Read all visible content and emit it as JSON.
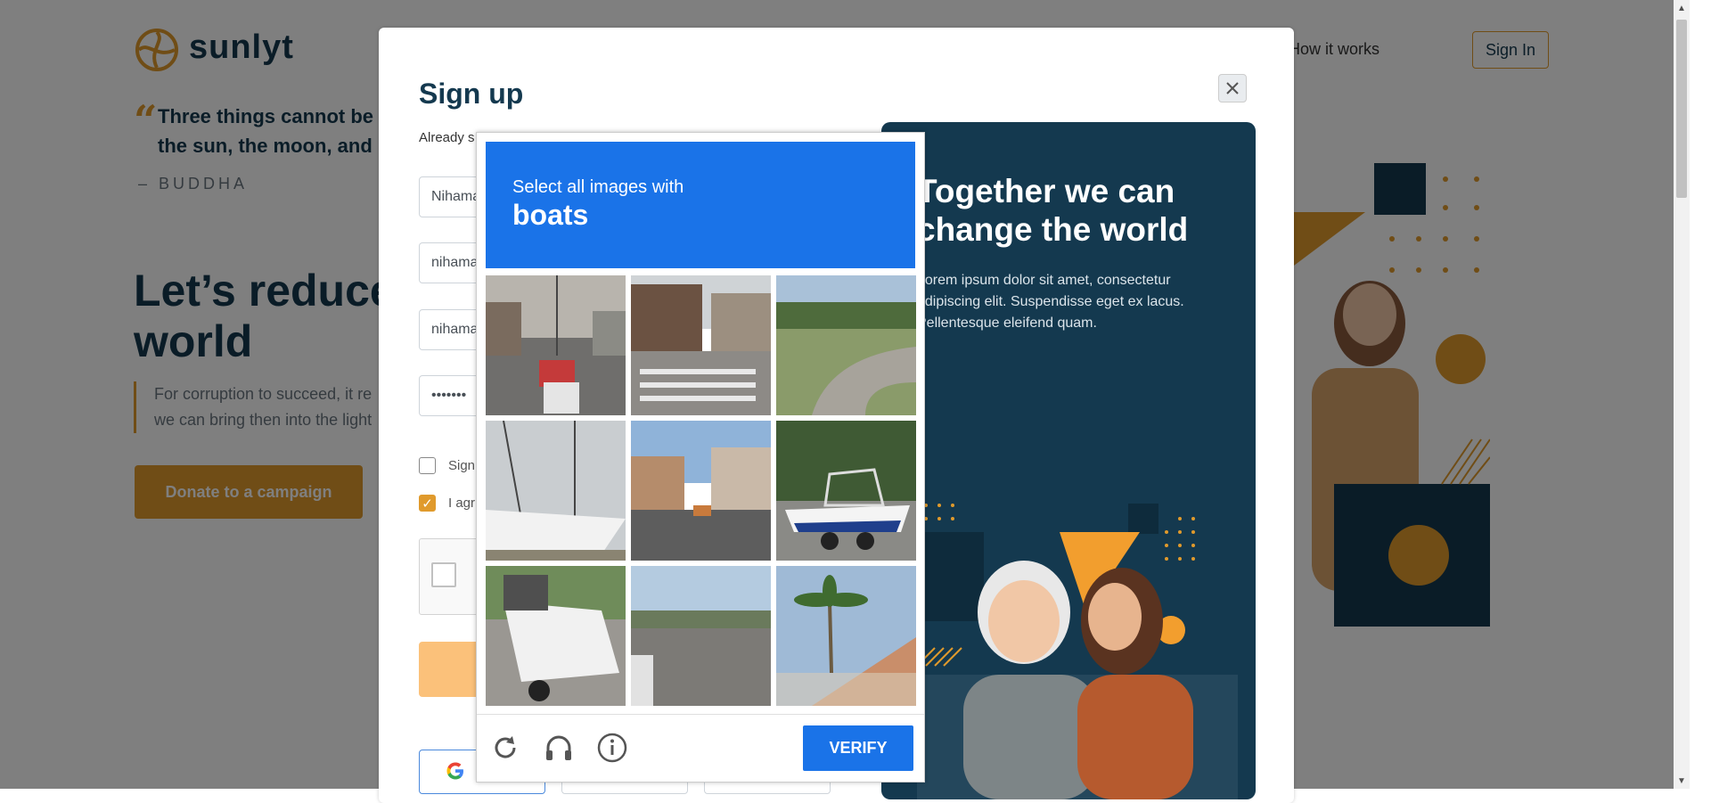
{
  "brand": {
    "name": "sunlyt"
  },
  "nav": {
    "how_it_works": "How it works",
    "sign_in": "Sign In"
  },
  "quote": {
    "line1": "Three things cannot be",
    "line2": "the sun, the moon, and",
    "author": "– BUDDHA"
  },
  "hero": {
    "title_line1": "Let’s reduce",
    "title_line2": "world",
    "sub_line1": "For corruption to succeed, it re",
    "sub_line2": "we can bring then into the light",
    "donate_label": "Donate to a campaign"
  },
  "modal": {
    "title": "Sign up",
    "subtitle": "Already s",
    "fields": [
      {
        "value": "Nihama"
      },
      {
        "value": "nihama"
      },
      {
        "value": "nihama"
      },
      {
        "value": "•••••••"
      }
    ],
    "checkbox1_label": "Sign",
    "checkbox2_label": "I agr",
    "checkbox2_checked": true,
    "panel": {
      "title_line1": "Together we can",
      "title_line2": "change the world",
      "text_line1": "Lorem ipsum dolor sit amet, consectetur",
      "text_line2": "adipiscing elit. Suspendisse eget ex lacus.",
      "text_line3": "Pellentesque eleifend quam."
    }
  },
  "captcha": {
    "instruction": "Select all images with",
    "target": "boats",
    "tiles": [
      {
        "name": "street-traffic"
      },
      {
        "name": "street-crosswalk"
      },
      {
        "name": "road-curve"
      },
      {
        "name": "boat-docked"
      },
      {
        "name": "city-street"
      },
      {
        "name": "speedboat-trailer"
      },
      {
        "name": "boat-trailer"
      },
      {
        "name": "highway"
      },
      {
        "name": "palm-house"
      }
    ],
    "verify_label": "VERIFY",
    "icons": [
      "reload-icon",
      "headphones-icon",
      "info-icon"
    ]
  },
  "colors": {
    "navy": "#14394f",
    "orange": "#e09a2c",
    "captcha_blue": "#1a73e8"
  }
}
